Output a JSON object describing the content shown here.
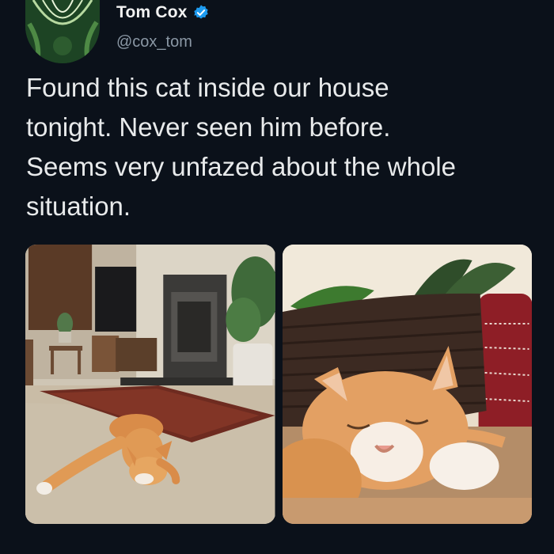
{
  "tweet": {
    "author": {
      "display_name": "Tom Cox",
      "handle": "@cox_tom",
      "verified": true,
      "verified_color": "#1d9bf0"
    },
    "text": "Found this cat inside our house\ntonight. Never seen him before.\nSeems very unfazed about the whole\nsituation.",
    "media": [
      {
        "icon": "photo-living-room-cat"
      },
      {
        "icon": "photo-cat-closeup"
      }
    ]
  },
  "colors": {
    "background": "#0b111a",
    "text_primary": "#e7e9ea",
    "text_secondary": "#8b98a5"
  }
}
